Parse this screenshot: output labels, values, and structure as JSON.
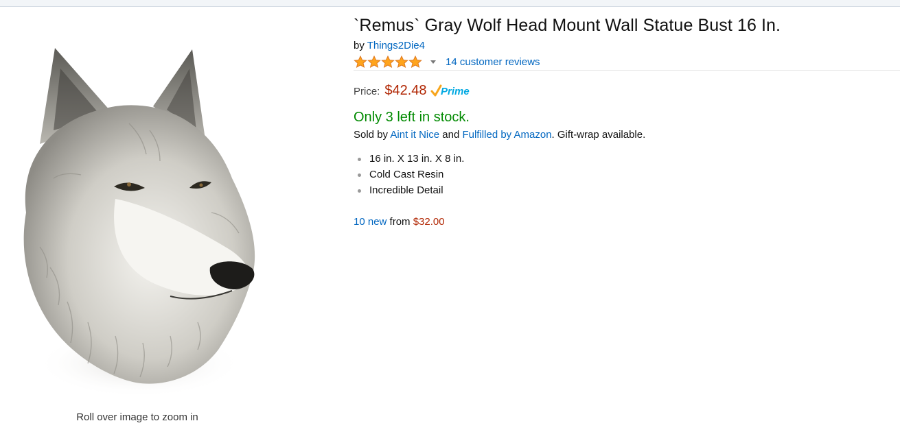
{
  "product": {
    "title": "`Remus` Gray Wolf Head Mount Wall Statue Bust 16 In.",
    "by_prefix": "by",
    "brand": "Things2Die4",
    "rating_stars": 5,
    "reviews_label": "14 customer reviews"
  },
  "image": {
    "zoom_hint": "Roll over image to zoom in"
  },
  "price": {
    "label": "Price:",
    "value": "$42.48",
    "prime_label": "Prime"
  },
  "availability": {
    "stock": "Only 3 left in stock.",
    "sold_by_prefix": "Sold by",
    "seller": "Aint it Nice",
    "and": "and",
    "fulfilled_by": "Fulfilled by Amazon",
    "gift_wrap": ". Gift-wrap available."
  },
  "features": [
    "16 in. X 13 in. X 8 in.",
    "Cold Cast Resin",
    "Incredible Detail"
  ],
  "offers": {
    "count_label": "10 new",
    "from": "from",
    "price": "$32.00"
  },
  "colors": {
    "link": "#0066c0",
    "price": "#b12704",
    "stock": "#008a00",
    "star": "#ffa41c",
    "prime": "#00a8e1"
  }
}
